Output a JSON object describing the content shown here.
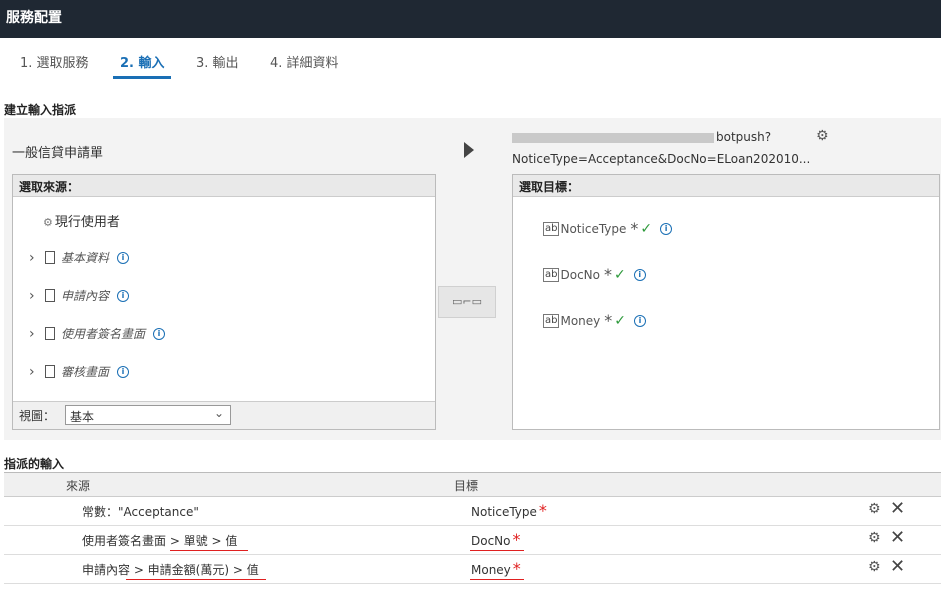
{
  "title": "服務配置",
  "tabs": [
    {
      "label": "1. 選取服務"
    },
    {
      "label": "2. 輸入"
    },
    {
      "label": "3. 輸出"
    },
    {
      "label": "4. 詳細資料"
    }
  ],
  "section_assign": "建立輸入指派",
  "source": {
    "name": "一般信貸申請單",
    "panel_title": "選取來源：",
    "current_user": "現行使用者",
    "items": [
      {
        "label": "基本資料"
      },
      {
        "label": "申請內容"
      },
      {
        "label": "使用者簽名畫面"
      },
      {
        "label": "審核畫面"
      }
    ],
    "view_label": "視圖：",
    "view_value": "基本"
  },
  "map_button_icon": "map-link-icon",
  "target": {
    "url_line1": "botpush?",
    "url_line2": "NoticeType=Acceptance&DocNo=ELoan202010...",
    "panel_title": "選取目標：",
    "items": [
      {
        "label": "NoticeType"
      },
      {
        "label": "DocNo"
      },
      {
        "label": "Money"
      }
    ],
    "required_mark": "*",
    "ab_label": "ab"
  },
  "section_assigned": "指派的輸入",
  "table": {
    "headers": {
      "source": "來源",
      "target": "目標"
    },
    "rows": [
      {
        "source": "常數：\"Acceptance\"",
        "target": "NoticeType"
      },
      {
        "source": "使用者簽名畫面 > 單號 > 值",
        "target": "DocNo"
      },
      {
        "source": "申請內容 > 申請金額(萬元) > 值",
        "target": "Money"
      }
    ]
  },
  "colors": {
    "titlebar": "#1f2833",
    "accent": "#1a6fb5",
    "check": "#2e9a3c",
    "required": "#e02020"
  }
}
